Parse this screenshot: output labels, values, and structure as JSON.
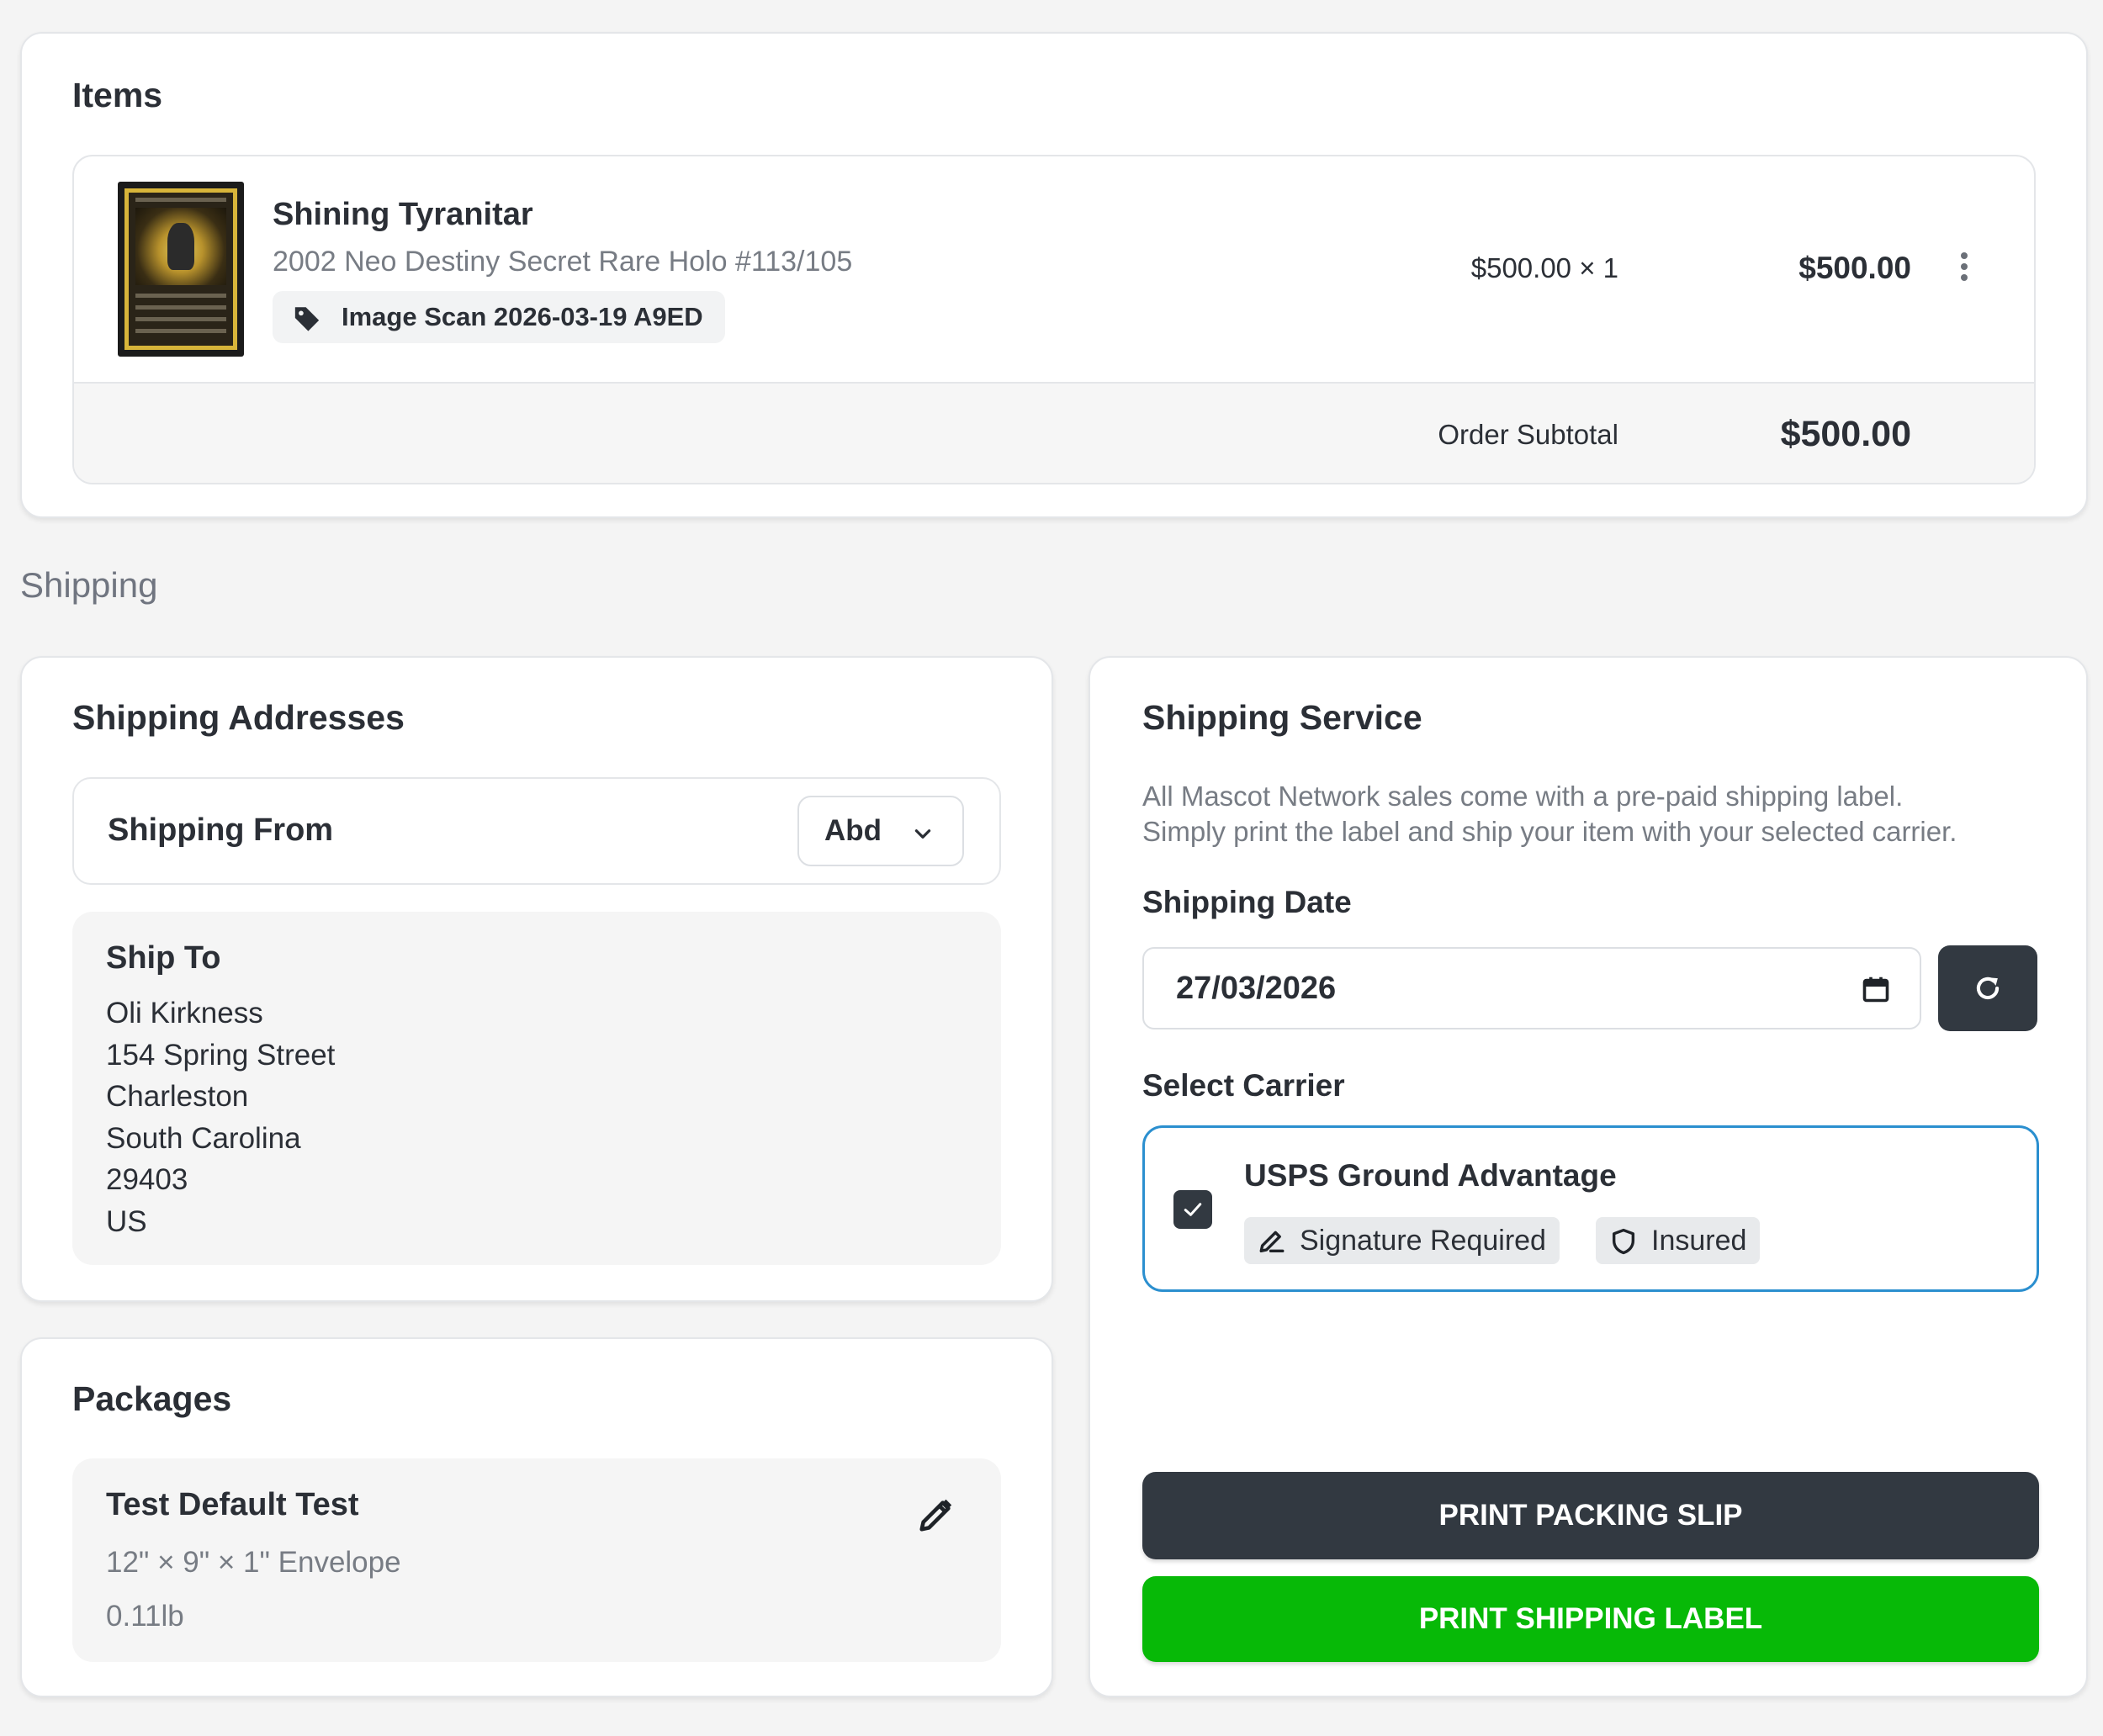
{
  "items": {
    "title": "Items",
    "product": {
      "name": "Shining Tyranitar",
      "subtitle": "2002 Neo Destiny Secret Rare Holo #113/105",
      "tag": "Image Scan 2026-03-19 A9ED",
      "price_qty": "$500.00 × 1",
      "total": "$500.00"
    },
    "subtotal_label": "Order Subtotal",
    "subtotal_value": "$500.00"
  },
  "section_heading": "Shipping",
  "addresses": {
    "title": "Shipping Addresses",
    "from_label": "Shipping From",
    "from_value": "Abd",
    "ship_to_title": "Ship To",
    "ship_to_lines": [
      "Oli Kirkness",
      "154 Spring Street",
      "Charleston",
      "South Carolina",
      "29403",
      "US"
    ]
  },
  "packages": {
    "title": "Packages",
    "package_name": "Test Default Test",
    "dimensions": "12\" × 9\" × 1\" Envelope",
    "weight": "0.11lb"
  },
  "service": {
    "title": "Shipping Service",
    "description_line1": "All Mascot Network sales come with a pre-paid shipping label.",
    "description_line2": "Simply print the label and ship your item with your selected carrier.",
    "date_label": "Shipping Date",
    "date_value": "27/03/2026",
    "carrier_label": "Select Carrier",
    "carrier_name": "USPS Ground Advantage",
    "carrier_selected": true,
    "badge_signature": "Signature Required",
    "badge_insured": "Insured",
    "print_packing_slip": "PRINT PACKING SLIP",
    "print_shipping_label": "PRINT SHIPPING LABEL"
  },
  "colors": {
    "dark": "#323941",
    "green": "#07b907",
    "selected_border": "#2b8fcf",
    "muted_text": "#777c84"
  },
  "icons": [
    "tag-icon",
    "kebab-menu-icon",
    "chevron-down-icon",
    "calendar-icon",
    "refresh-icon",
    "checkmark-icon",
    "signature-icon",
    "shield-icon",
    "pencil-icon"
  ]
}
